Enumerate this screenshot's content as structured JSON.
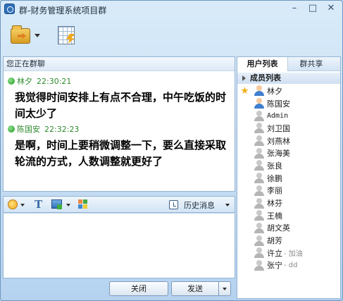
{
  "window": {
    "title": "群-财务管理系统项目群",
    "minimize_glyph": "–",
    "maximize_glyph": "□",
    "close_glyph": "✕"
  },
  "chat": {
    "header": "您正在群聊",
    "messages": [
      {
        "sender": "林夕",
        "time": "22:30:21",
        "text": "我觉得时间安排上有点不合理，中午吃饭的时间太少了"
      },
      {
        "sender": "陈国安",
        "time": "22:32:23",
        "text": "是啊，时间上要稍微调整一下，要么直接采取轮流的方式，人数调整就更好了"
      }
    ]
  },
  "input_toolbar": {
    "font_glyph": "T",
    "history_label": "历史消息"
  },
  "input": {
    "value": "",
    "placeholder": ""
  },
  "buttons": {
    "close_label": "关闭",
    "send_label": "发送"
  },
  "side": {
    "tabs": [
      "用户列表",
      "群共享"
    ],
    "group_label": "成员列表",
    "members": [
      {
        "name": "林夕",
        "status": "",
        "online": true,
        "starred": true
      },
      {
        "name": "陈国安",
        "status": "",
        "online": true,
        "starred": false
      },
      {
        "name": "Admin",
        "status": "",
        "online": false,
        "starred": false
      },
      {
        "name": "刘卫国",
        "status": "",
        "online": false,
        "starred": false
      },
      {
        "name": "刘燕林",
        "status": "",
        "online": false,
        "starred": false
      },
      {
        "name": "张海美",
        "status": "",
        "online": false,
        "starred": false
      },
      {
        "name": "张良",
        "status": "",
        "online": false,
        "starred": false
      },
      {
        "name": "徐鹏",
        "status": "",
        "online": false,
        "starred": false
      },
      {
        "name": "李丽",
        "status": "",
        "online": false,
        "starred": false
      },
      {
        "name": "林芬",
        "status": "",
        "online": false,
        "starred": false
      },
      {
        "name": "王楠",
        "status": "",
        "online": false,
        "starred": false
      },
      {
        "name": "胡文英",
        "status": "",
        "online": false,
        "starred": false
      },
      {
        "name": "胡芳",
        "status": "",
        "online": false,
        "starred": false
      },
      {
        "name": "许立",
        "status": "- 加油",
        "online": false,
        "starred": false
      },
      {
        "name": "张宁",
        "status": "- dd",
        "online": false,
        "starred": false
      }
    ]
  },
  "colors": {
    "accent": "#2e6fb8",
    "online_green": "#2e8b2e",
    "frame": "#95b3d2"
  }
}
